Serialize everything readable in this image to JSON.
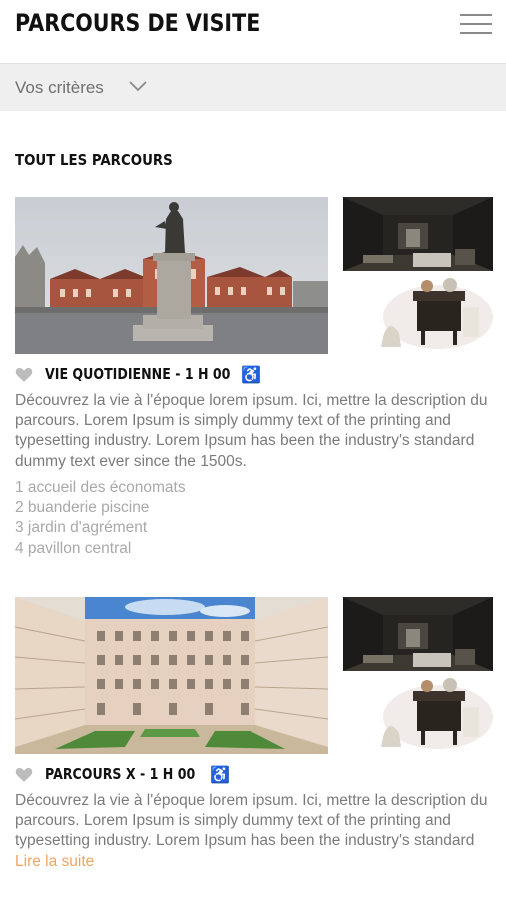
{
  "header": {
    "title": "PARCOURS DE VISITE",
    "menu_icon": "hamburger-menu-icon"
  },
  "filter": {
    "label": "Vos critères",
    "icon": "chevron-down-icon"
  },
  "section": {
    "title": "TOUT LES PARCOURS"
  },
  "routes": [
    {
      "title": "VIE QUOTIDIENNE - 1 H 00",
      "favorite_icon": "heart-icon",
      "accessibility_icon": "wheelchair-icon",
      "description": "Découvrez la vie à l'époque lorem ipsum. Ici, mettre la description du parcours. Lorem Ipsum is simply dummy text of the printing and typesetting industry. Lorem Ipsum has been the industry's standard dummy text ever since the 1500s.",
      "stops": [
        "1 accueil des économats",
        "2 buanderie piscine",
        "3 jardin d'agrément",
        "4 pavillon central"
      ]
    },
    {
      "title": "PARCOURS X - 1 H 00",
      "favorite_icon": "heart-icon",
      "accessibility_icon": "wheelchair-icon",
      "description": "Découvrez la vie à l'époque lorem ipsum. Ici, mettre la description du parcours. Lorem Ipsum is simply dummy text of the printing and typesetting industry. Lorem Ipsum has been the industry's standard",
      "read_more": "Lire la suite"
    }
  ],
  "colors": {
    "accent": "#f0a55b",
    "text_muted": "#7b7b7b",
    "filter_bg": "#efefef"
  }
}
